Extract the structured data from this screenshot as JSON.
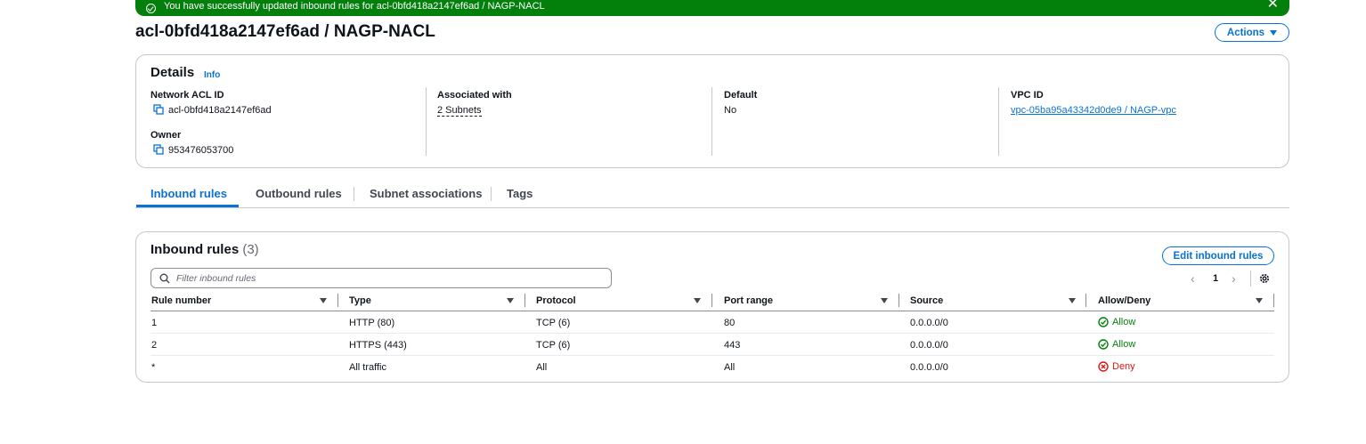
{
  "flash": {
    "message": "You have successfully updated inbound rules for acl-0bfd418a2147ef6ad / NAGP-NACL",
    "close": "✕",
    "color": "#037f0c"
  },
  "page_title": "acl-0bfd418a2147ef6ad / NAGP-NACL",
  "actions_label": "Actions",
  "details": {
    "title": "Details",
    "info": "Info",
    "network_acl_id_label": "Network ACL ID",
    "network_acl_id": "acl-0bfd418a2147ef6ad",
    "owner_label": "Owner",
    "owner": "953476053700",
    "associated_label": "Associated with",
    "associated": "2 Subnets",
    "default_label": "Default",
    "default": "No",
    "vpc_label": "VPC ID",
    "vpc": "vpc-05ba95a43342d0de9 / NAGP-vpc"
  },
  "tabs": [
    {
      "label": "Inbound rules",
      "active": true
    },
    {
      "label": "Outbound rules"
    },
    {
      "label": "Subnet associations"
    },
    {
      "label": "Tags"
    }
  ],
  "rules": {
    "title": "Inbound rules",
    "count": "(3)",
    "edit_label": "Edit inbound rules",
    "filter_placeholder": "Filter inbound rules",
    "page": "1",
    "columns": [
      "Rule number",
      "Type",
      "Protocol",
      "Port range",
      "Source",
      "Allow/Deny"
    ],
    "rows": [
      {
        "rule": "1",
        "type": "HTTP (80)",
        "protocol": "TCP (6)",
        "port": "80",
        "source": "0.0.0.0/0",
        "action": "Allow"
      },
      {
        "rule": "2",
        "type": "HTTPS (443)",
        "protocol": "TCP (6)",
        "port": "443",
        "source": "0.0.0.0/0",
        "action": "Allow"
      },
      {
        "rule": "*",
        "type": "All traffic",
        "protocol": "All",
        "port": "All",
        "source": "0.0.0.0/0",
        "action": "Deny"
      }
    ]
  },
  "colors": {
    "accent": "#0972d3",
    "allow": "#037f0c",
    "deny": "#d91515"
  }
}
